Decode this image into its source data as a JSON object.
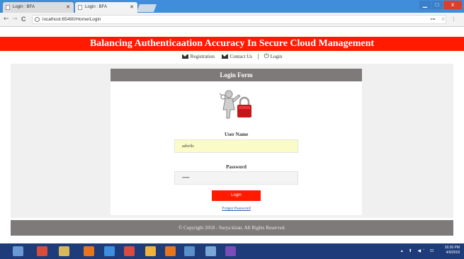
{
  "browser": {
    "tabs": [
      {
        "label": "Login : BFA",
        "active": false
      },
      {
        "label": "Login : BFA",
        "active": true
      }
    ],
    "url": "localhost:65490/Home/Login",
    "back": "←",
    "forward": "→",
    "reload": "C",
    "win_minimize": "▁",
    "win_maximize": "□",
    "win_close": "x",
    "chrome_icons": "⊶ ☆ ⋮"
  },
  "header": {
    "title": "Balancing Authenticaation Accuracy In Secure Cloud Management"
  },
  "nav": {
    "registration": "Registration",
    "contact": "Contact Us",
    "login": "Login",
    "power_glyph": "⏻"
  },
  "login_form": {
    "title": "Login Form",
    "username_label": "User Name",
    "username_value": "ashvils",
    "password_label": "Password",
    "password_value": "•••••",
    "login_button": "Login",
    "forgot_link": "Forgot Password"
  },
  "footer": {
    "copyright": "© Copyright 2018 - Surya kiran. All Rights Reserved."
  },
  "taskbar": {
    "time": "16:36 PM",
    "date": "4/9/2018",
    "tray": "▴ ⬆ ◀ʼ ⊡",
    "icon_colors": [
      "#6a9ad6",
      "#d84c3c",
      "#d9b85a",
      "#e8741c",
      "#3c8fe0",
      "#d94b3f",
      "#f0b23a",
      "#e8741c",
      "#5b8fc9",
      "#7aa6d6",
      "#7b4bb8"
    ]
  },
  "colors": {
    "accent_red": "#ff1a00",
    "panel_gray": "#7f7a7a",
    "taskbar": "#1e3b7a",
    "titlebar": "#3f8ddb"
  }
}
